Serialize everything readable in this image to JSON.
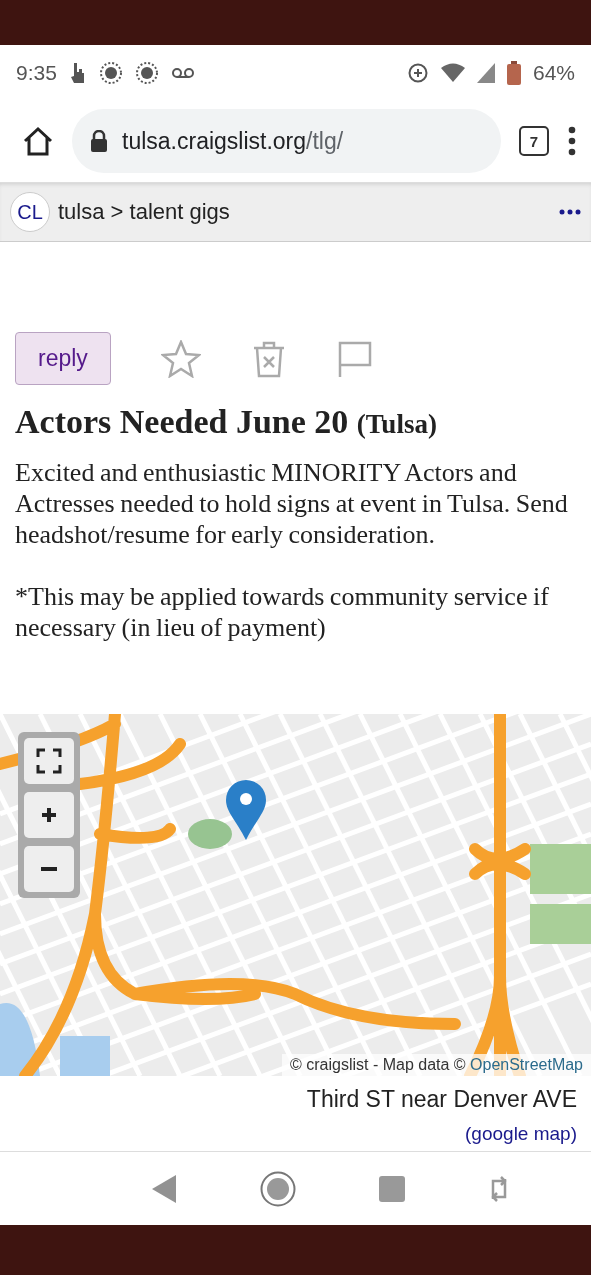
{
  "status_bar": {
    "time": "9:35",
    "battery": "64%"
  },
  "browser": {
    "url_host": "tulsa.craigslist.org",
    "url_path": "/tlg/",
    "tab_count": "7"
  },
  "breadcrumb": {
    "logo": "CL",
    "path": "tulsa > talent gigs"
  },
  "post": {
    "reply": "reply",
    "title": "Actors Needed June 20",
    "location": "(Tulsa)",
    "paragraphs": [
      "Excited and enthusiastic MINORITY Actors and Actresses needed to hold signs at event in Tulsa. Send headshot/resume for early consideration.",
      "*This may be applied towards community service if necessary (in lieu of payment)"
    ]
  },
  "map": {
    "attribution": "© craigslist - Map data © ",
    "attribution_link": "OpenStreetMap"
  },
  "address": "Third ST near Denver AVE",
  "map_link": "(google map)"
}
